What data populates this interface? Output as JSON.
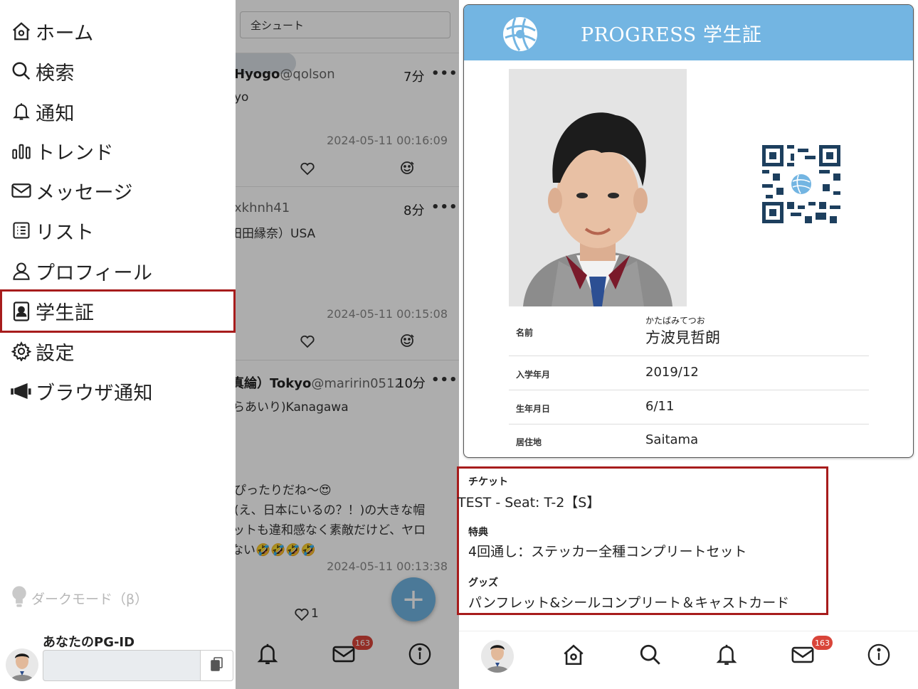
{
  "sidebar": {
    "items": [
      {
        "label": "ホーム",
        "icon": "home-icon"
      },
      {
        "label": "検索",
        "icon": "search-icon"
      },
      {
        "label": "通知",
        "icon": "bell-icon"
      },
      {
        "label": "トレンド",
        "icon": "bar-chart-icon"
      },
      {
        "label": "メッセージ",
        "icon": "envelope-icon"
      },
      {
        "label": "リスト",
        "icon": "list-icon"
      },
      {
        "label": "プロフィール",
        "icon": "person-icon"
      },
      {
        "label": "学生証",
        "icon": "id-card-icon",
        "active": true
      },
      {
        "label": "設定",
        "icon": "gear-icon"
      },
      {
        "label": "ブラウザ通知",
        "icon": "megaphone-icon"
      }
    ],
    "dark_mode_label": "ダークモード（β）",
    "pg_id_label": "あなたのPG-ID",
    "pg_id_value": ""
  },
  "feed": {
    "search_value": "全シュート",
    "posts": [
      {
        "name": "Hyogo",
        "handle": "@qolson",
        "time": "7分",
        "more": "•••",
        "lines": [
          "yo"
        ],
        "date": "2024-05-11 00:16:09",
        "likes": ""
      },
      {
        "name": "",
        "handle": "xkhnh41",
        "time": "8分",
        "more": "•••",
        "lines": [
          "田田縁奈）USA"
        ],
        "date": "2024-05-11 00:15:08",
        "likes": ""
      },
      {
        "name": "真綸）Tokyo",
        "handle": "@maririn0512",
        "time": "10分",
        "more": "•••",
        "lines": [
          "らあいり)Kanagawa",
          "",
          "ぴったりだね～😍",
          "(え、日本にいるの？！)の大きな帽",
          "ットも違和感なく素敵だけど、ヤロ",
          "ない🤣🤣🤣🤣"
        ],
        "date": "2024-05-11 00:13:38",
        "likes": "1"
      }
    ],
    "fab_label": "+",
    "mail_badge": "163"
  },
  "student_card": {
    "header_title": "PROGRESS 学生証",
    "name_label": "名前",
    "furigana": "かたばみてつお",
    "name": "方波見哲朗",
    "enroll_label": "入学年月",
    "enroll_value": "2019/12",
    "birth_label": "生年月日",
    "birth_value": "6/11",
    "residence_label": "居住地",
    "residence_value": "Saitama"
  },
  "ticket": {
    "ticket_label": "チケット",
    "ticket_value": "TEST - Seat: T-2【S】",
    "benefit_label": "特典",
    "benefit_value": "4回通し：ステッカー全種コンプリートセット",
    "goods_label": "グッズ",
    "goods_value": "パンフレット&シールコンプリート＆キャストカード"
  },
  "bottom_nav": {
    "mail_badge": "163"
  },
  "colors": {
    "header_blue": "#73b5e2",
    "highlight_red": "#a71c1c",
    "qr_navy": "#1d3f5e",
    "badge_red": "#d9453a"
  }
}
